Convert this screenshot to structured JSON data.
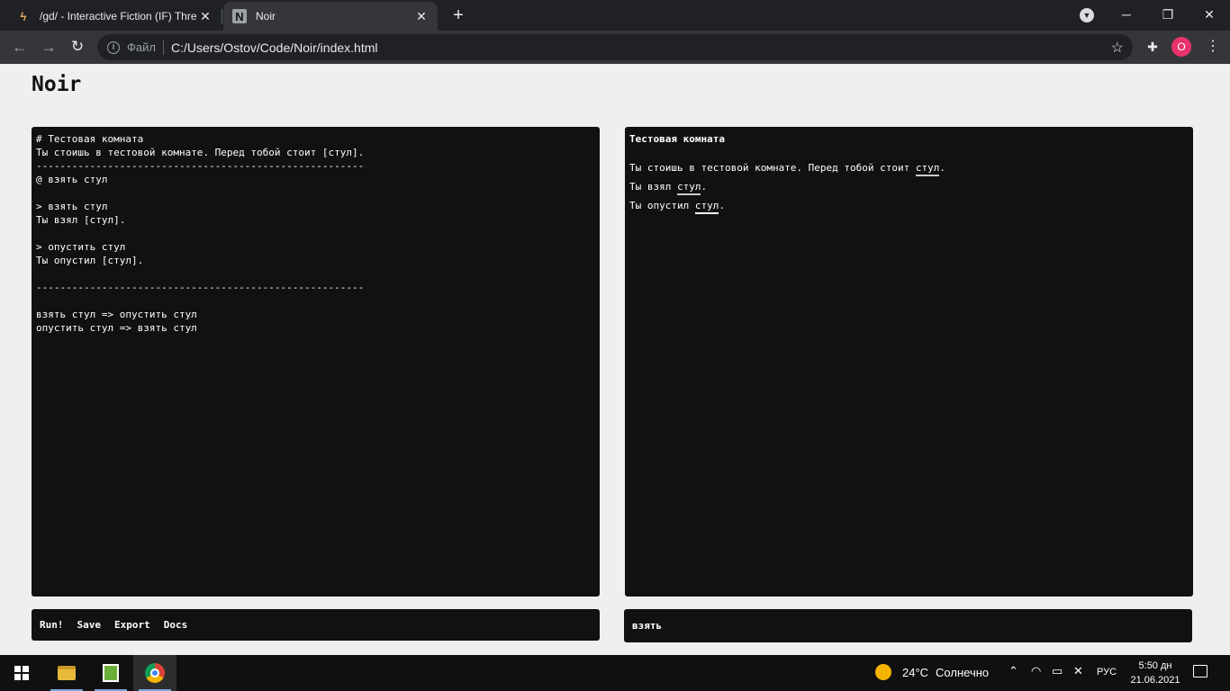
{
  "browser": {
    "tabs": [
      {
        "title": "/gd/ - Interactive Fiction (IF) Thre",
        "favicon": "lightning-icon",
        "active": false
      },
      {
        "title": "Noir",
        "favicon": "n-icon",
        "active": true
      }
    ],
    "new_tab": "+",
    "omnibox": {
      "scheme_label": "Файл",
      "url": "C:/Users/Ostov/Code/Noir/index.html"
    },
    "profile_initial": "O",
    "profile_color": "#e8336d"
  },
  "app": {
    "title": "Noir",
    "editor_text": "# Тестовая комната\nТы стоишь в тестовой комнате. Перед тобой стоит [стул].\n-------------------------------------------------------\n@ взять стул\n\n> взять стул\nТы взял [стул].\n\n> опустить стул\nТы опустил [стул].\n\n-------------------------------------------------------\n\nвзять стул => опустить стул\nопустить стул => взять стул",
    "output": {
      "heading": "Тестовая комната",
      "lines": [
        {
          "before": "Ты стоишь в тестовой комнате. Перед тобой стоит ",
          "keyword": "стул",
          "after": "."
        },
        {
          "before": "Ты взял ",
          "keyword": "стул",
          "after": "."
        },
        {
          "before": "Ты опустил ",
          "keyword": "стул",
          "after": "."
        }
      ]
    },
    "actions": [
      "Run!",
      "Save",
      "Export",
      "Docs"
    ],
    "command_input": "взять"
  },
  "taskbar": {
    "weather": {
      "temp": "24°C",
      "condition": "Солнечно"
    },
    "language": "РУС",
    "time": "5:50 дн",
    "date": "21.06.2021"
  }
}
